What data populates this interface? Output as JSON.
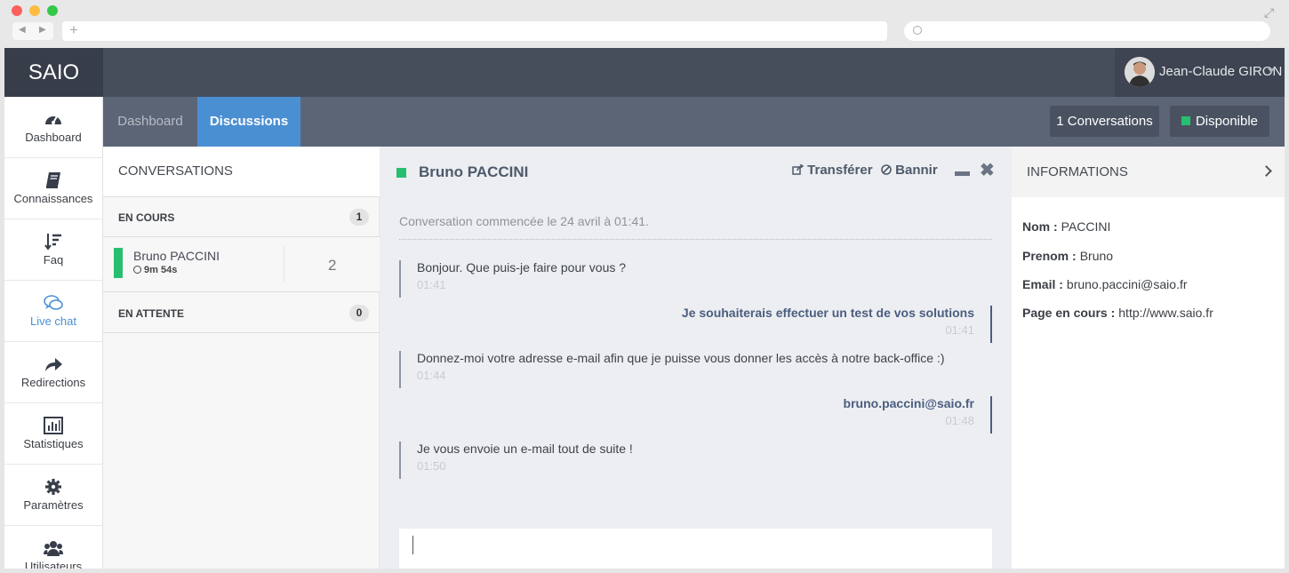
{
  "app": {
    "brand": "SAIO"
  },
  "user": {
    "name": "Jean-Claude GIRON"
  },
  "tabs": {
    "dashboard": "Dashboard",
    "discussions": "Discussions"
  },
  "status": {
    "conversations": "1 Conversations",
    "availability": "Disponible"
  },
  "sidebar": {
    "items": [
      {
        "label": "Dashboard",
        "icon": "dashboard-icon"
      },
      {
        "label": "Connaissances",
        "icon": "book-icon"
      },
      {
        "label": "Faq",
        "icon": "sort-icon"
      },
      {
        "label": "Live chat",
        "icon": "chat-icon"
      },
      {
        "label": "Redirections",
        "icon": "share-icon"
      },
      {
        "label": "Statistiques",
        "icon": "stats-icon"
      },
      {
        "label": "Paramètres",
        "icon": "gear-icon"
      },
      {
        "label": "Utilisateurs",
        "icon": "users-icon"
      }
    ]
  },
  "conversations": {
    "title": "CONVERSATIONS",
    "in_progress": {
      "label": "EN COURS",
      "count": "1"
    },
    "waiting": {
      "label": "EN ATTENTE",
      "count": "0"
    },
    "item": {
      "name": "Bruno PACCINI",
      "duration": "9m 54s",
      "messages": "2"
    }
  },
  "chat": {
    "contact": "Bruno PACCINI",
    "transfer": "Transférer",
    "ban": "Bannir",
    "started": "Conversation commencée le 24 avril à 01:41.",
    "messages": [
      {
        "text": "Bonjour. Que puis-je faire pour vous ?",
        "time": "01:41"
      },
      {
        "text": "Je souhaiterais effectuer un test de vos solutions",
        "time": "01:41"
      },
      {
        "text": "Donnez-moi votre adresse e-mail afin que je puisse vous donner les accès à notre back-office :)",
        "time": "01:44"
      },
      {
        "text": "bruno.paccini@saio.fr",
        "time": "01:48"
      },
      {
        "text": "Je vous envoie un e-mail tout de suite !",
        "time": "01:50"
      }
    ]
  },
  "info": {
    "title": "INFORMATIONS",
    "nom_label": "Nom :",
    "nom": "PACCINI",
    "prenom_label": "Prenom :",
    "prenom": "Bruno",
    "email_label": "Email :",
    "email": "bruno.paccini@saio.fr",
    "page_label": "Page en cours :",
    "page": "http://www.saio.fr"
  },
  "colors": {
    "accent": "#4b8fd3",
    "online": "#26bf70",
    "topbar": "#464d5b"
  }
}
